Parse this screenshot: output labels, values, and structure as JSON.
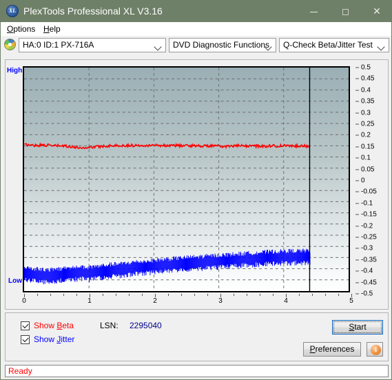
{
  "window": {
    "title": "PlexTools Professional XL V3.16",
    "icon": "xl-disc-icon",
    "minimize_label": "–",
    "maximize_label": "□",
    "close_label": "✕"
  },
  "menubar": {
    "items": [
      {
        "label": "Options",
        "mnemonic": "O"
      },
      {
        "label": "Help",
        "mnemonic": "H"
      }
    ]
  },
  "toolbar": {
    "drive_icon": "disc-icon",
    "drive_combo": {
      "value": "HA:0 ID:1  PX-716A",
      "options": [
        "HA:0 ID:1  PX-716A"
      ]
    },
    "function_combo": {
      "value": "DVD Diagnostic Functions",
      "options": [
        "DVD Diagnostic Functions"
      ]
    },
    "test_combo": {
      "value": "Q-Check Beta/Jitter Test",
      "options": [
        "Q-Check Beta/Jitter Test"
      ]
    }
  },
  "chart_labels": {
    "high": "High",
    "low": "Low"
  },
  "controls": {
    "show_beta": {
      "label": "Show Beta",
      "mnemonic": "B",
      "checked": true,
      "color": "#ff0000"
    },
    "show_jitter": {
      "label": "Show Jitter",
      "mnemonic": "J",
      "checked": true,
      "color": "#0000ff"
    },
    "lsn_label": "LSN:",
    "lsn_value": "2295040",
    "start_button": "Start",
    "preferences_button": "Preferences",
    "info_button": "i"
  },
  "statusbar": {
    "text": "Ready"
  },
  "chart_data": {
    "type": "line",
    "title": "Q-Check Beta/Jitter Test",
    "xlabel": "",
    "ylabel": "",
    "xlim": [
      0,
      5
    ],
    "ylim": [
      -0.5,
      0.5
    ],
    "grid": true,
    "legend_position": "bottom-left",
    "x_ticks": [
      0,
      1,
      2,
      3,
      4,
      5
    ],
    "y_ticks": [
      0.5,
      0.45,
      0.4,
      0.35,
      0.3,
      0.25,
      0.2,
      0.15,
      0.1,
      0.05,
      0,
      -0.05,
      -0.1,
      -0.15,
      -0.2,
      -0.25,
      -0.3,
      -0.35,
      -0.4,
      -0.45,
      -0.5
    ],
    "data_end_x": 4.4,
    "end_marker_x": 4.4,
    "series": [
      {
        "name": "Show Beta",
        "color": "#ff0000",
        "type": "line",
        "x": [
          0.0,
          0.1,
          0.2,
          0.3,
          0.4,
          0.5,
          0.6,
          0.7,
          0.8,
          0.9,
          1.0,
          1.1,
          1.2,
          1.3,
          1.4,
          1.5,
          1.6,
          1.7,
          1.8,
          1.9,
          2.0,
          2.1,
          2.2,
          2.3,
          2.4,
          2.5,
          2.6,
          2.7,
          2.8,
          2.9,
          3.0,
          3.1,
          3.2,
          3.3,
          3.4,
          3.5,
          3.6,
          3.7,
          3.8,
          3.9,
          4.0,
          4.1,
          4.2,
          4.3,
          4.4
        ],
        "values": [
          0.155,
          0.153,
          0.152,
          0.154,
          0.151,
          0.15,
          0.149,
          0.147,
          0.143,
          0.141,
          0.143,
          0.146,
          0.148,
          0.15,
          0.151,
          0.15,
          0.152,
          0.151,
          0.153,
          0.152,
          0.153,
          0.152,
          0.151,
          0.152,
          0.151,
          0.15,
          0.151,
          0.15,
          0.149,
          0.15,
          0.148,
          0.147,
          0.149,
          0.15,
          0.149,
          0.15,
          0.149,
          0.148,
          0.15,
          0.149,
          0.15,
          0.149,
          0.15,
          0.15,
          0.149
        ],
        "noise_amplitude": 0.006
      },
      {
        "name": "Show Jitter",
        "color": "#0000ff",
        "type": "noise-band",
        "x": [
          0.0,
          0.1,
          0.2,
          0.3,
          0.4,
          0.5,
          0.6,
          0.7,
          0.8,
          0.9,
          1.0,
          1.1,
          1.2,
          1.3,
          1.4,
          1.5,
          1.6,
          1.7,
          1.8,
          1.9,
          2.0,
          2.1,
          2.2,
          2.3,
          2.4,
          2.5,
          2.6,
          2.7,
          2.8,
          2.9,
          3.0,
          3.1,
          3.2,
          3.3,
          3.4,
          3.5,
          3.6,
          3.7,
          3.8,
          3.9,
          4.0,
          4.1,
          4.2,
          4.3,
          4.4
        ],
        "values": [
          -0.42,
          -0.424,
          -0.428,
          -0.432,
          -0.43,
          -0.428,
          -0.425,
          -0.423,
          -0.42,
          -0.418,
          -0.422,
          -0.418,
          -0.412,
          -0.408,
          -0.406,
          -0.404,
          -0.4,
          -0.396,
          -0.394,
          -0.392,
          -0.388,
          -0.386,
          -0.383,
          -0.381,
          -0.378,
          -0.376,
          -0.374,
          -0.372,
          -0.37,
          -0.368,
          -0.366,
          -0.364,
          -0.362,
          -0.36,
          -0.358,
          -0.356,
          -0.354,
          -0.352,
          -0.35,
          -0.349,
          -0.348,
          -0.347,
          -0.346,
          -0.346,
          -0.347
        ],
        "band_half_width": 0.03,
        "noise_amplitude": 0.03
      }
    ]
  }
}
